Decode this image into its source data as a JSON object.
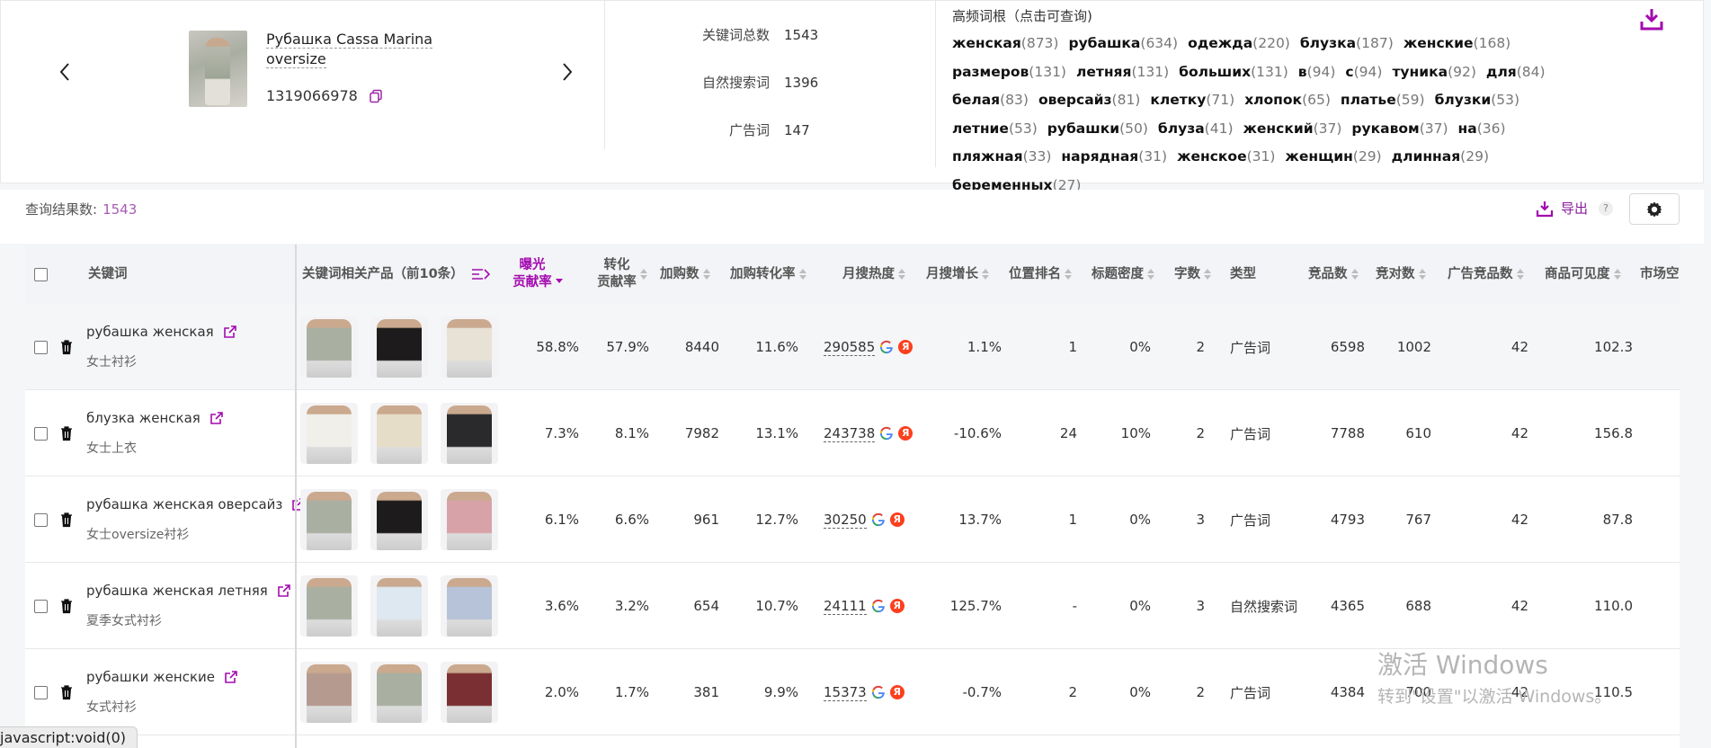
{
  "product": {
    "name": "Рубашка Cassa Marina oversize",
    "sku": "1319066978"
  },
  "stats": [
    {
      "label": "关键词总数",
      "value": "1543"
    },
    {
      "label": "自然搜索词",
      "value": "1396"
    },
    {
      "label": "广告词",
      "value": "147"
    }
  ],
  "roots": {
    "title": "高频词根（点击可查询)",
    "items": [
      {
        "w": "женская",
        "c": "(873)"
      },
      {
        "w": "рубашка",
        "c": "(634)"
      },
      {
        "w": "одежда",
        "c": "(220)"
      },
      {
        "w": "блузка",
        "c": "(187)"
      },
      {
        "w": "женские",
        "c": "(168)"
      },
      {
        "w": "размеров",
        "c": "(131)"
      },
      {
        "w": "летняя",
        "c": "(131)"
      },
      {
        "w": "больших",
        "c": "(131)"
      },
      {
        "w": "в",
        "c": "(94)"
      },
      {
        "w": "с",
        "c": "(94)"
      },
      {
        "w": "туника",
        "c": "(92)"
      },
      {
        "w": "для",
        "c": "(84)"
      },
      {
        "w": "белая",
        "c": "(83)"
      },
      {
        "w": "оверсайз",
        "c": "(81)"
      },
      {
        "w": "клетку",
        "c": "(71)"
      },
      {
        "w": "хлопок",
        "c": "(65)"
      },
      {
        "w": "платье",
        "c": "(59)"
      },
      {
        "w": "блузки",
        "c": "(53)"
      },
      {
        "w": "летние",
        "c": "(53)"
      },
      {
        "w": "рубашки",
        "c": "(50)"
      },
      {
        "w": "блуза",
        "c": "(41)"
      },
      {
        "w": "женский",
        "c": "(37)"
      },
      {
        "w": "рукавом",
        "c": "(37)"
      },
      {
        "w": "на",
        "c": "(36)"
      },
      {
        "w": "пляжная",
        "c": "(33)"
      },
      {
        "w": "нарядная",
        "c": "(31)"
      },
      {
        "w": "женское",
        "c": "(31)"
      },
      {
        "w": "женщин",
        "c": "(29)"
      },
      {
        "w": "длинная",
        "c": "(29)"
      },
      {
        "w": "беременных",
        "c": "(27)"
      }
    ]
  },
  "results": {
    "label": "查询结果数:",
    "count": "1543",
    "export_label": "导出",
    "help": "?"
  },
  "columns": {
    "keyword": "关键词",
    "products": "关键词相关产品（前10条）",
    "exposure_1": "曝光",
    "exposure_2": "贡献率",
    "conversion_1": "转化",
    "conversion_2": "贡献率",
    "cart": "加购数",
    "cart_rate": "加购转化率",
    "heat": "月搜热度",
    "growth": "月搜增长",
    "rank": "位置排名",
    "density": "标题密度",
    "chars": "字数",
    "type": "类型",
    "competitors": "竞品数",
    "rivals": "竞对数",
    "ad_competitors": "广告竞品数",
    "visibility": "商品可见度",
    "market": "市场空"
  },
  "rows": [
    {
      "kw": "рубашка женская",
      "zh": "女士衬衫",
      "exp": "58.8%",
      "conv": "57.9%",
      "cart": "8440",
      "cart_rate": "11.6%",
      "heat": "290585",
      "growth": "1.1%",
      "rank": "1",
      "density": "0%",
      "chars": "2",
      "type": "广告词",
      "comp": "6598",
      "rivals": "1002",
      "ad": "42",
      "vis": "102.3"
    },
    {
      "kw": "блузка женская",
      "zh": "女士上衣",
      "exp": "7.3%",
      "conv": "8.1%",
      "cart": "7982",
      "cart_rate": "13.1%",
      "heat": "243738",
      "growth": "-10.6%",
      "rank": "24",
      "density": "10%",
      "chars": "2",
      "type": "广告词",
      "comp": "7788",
      "rivals": "610",
      "ad": "42",
      "vis": "156.8"
    },
    {
      "kw": "рубашка женская оверсайз",
      "zh": "女士oversize衬衫",
      "exp": "6.1%",
      "conv": "6.6%",
      "cart": "961",
      "cart_rate": "12.7%",
      "heat": "30250",
      "growth": "13.7%",
      "rank": "1",
      "density": "0%",
      "chars": "3",
      "type": "广告词",
      "comp": "4793",
      "rivals": "767",
      "ad": "42",
      "vis": "87.8"
    },
    {
      "kw": "рубашка женская летняя",
      "zh": "夏季女式衬衫",
      "exp": "3.6%",
      "conv": "3.2%",
      "cart": "654",
      "cart_rate": "10.7%",
      "heat": "24111",
      "growth": "125.7%",
      "rank": "-",
      "density": "0%",
      "chars": "3",
      "type": "自然搜索词",
      "comp": "4365",
      "rivals": "688",
      "ad": "42",
      "vis": "110.0"
    },
    {
      "kw": "рубашки женские",
      "zh": "女式衬衫",
      "exp": "2.0%",
      "conv": "1.7%",
      "cart": "381",
      "cart_rate": "9.9%",
      "heat": "15373",
      "growth": "-0.7%",
      "rank": "2",
      "density": "0%",
      "chars": "2",
      "type": "广告词",
      "comp": "4384",
      "rivals": "700",
      "ad": "42",
      "vis": "110.5"
    }
  ],
  "thumb_colors": [
    [
      "#a9b0a2",
      "#1d1b1b",
      "#e8e2d6"
    ],
    [
      "#f1efe9",
      "#e6ddc9",
      "#2a2a2c"
    ],
    [
      "#a9b0a2",
      "#1d1b1b",
      "#d7a3a8"
    ],
    [
      "#a9b0a2",
      "#dde8f0",
      "#b6c3d8"
    ],
    [
      "#b59a8f",
      "#a9b0a2",
      "#7a2f33"
    ]
  ],
  "watermark": {
    "line1": "激活 Windows",
    "line2": "转到\"设置\"以激活 Windows。"
  },
  "status": "javascript:void(0)"
}
